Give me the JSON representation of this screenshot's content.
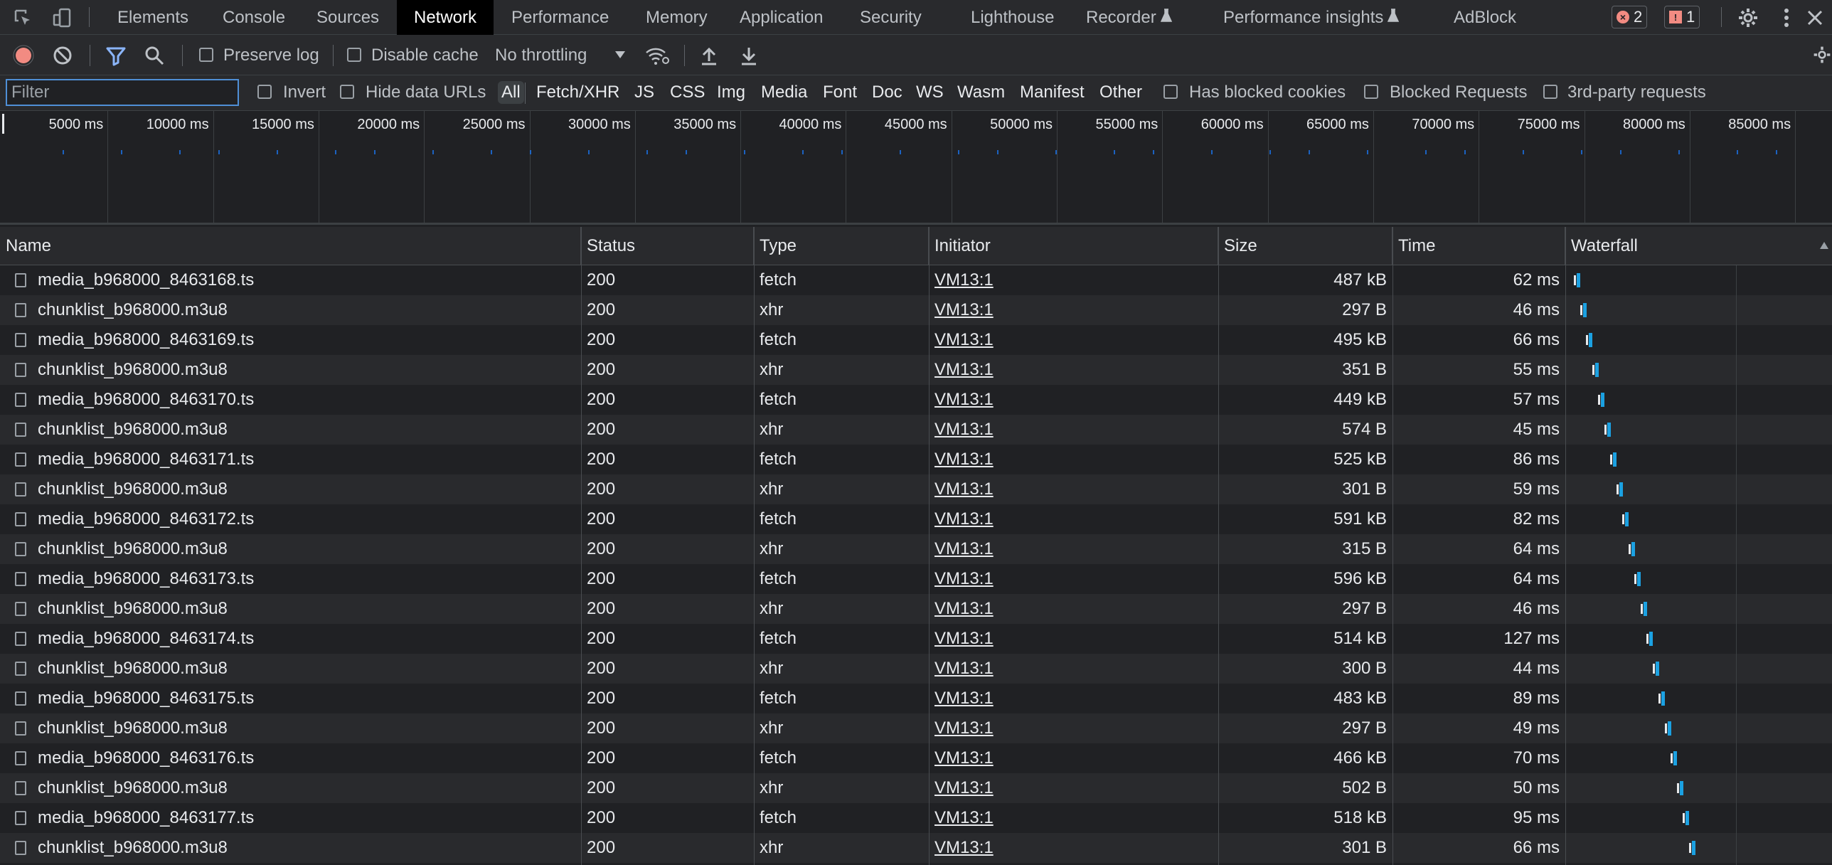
{
  "tabs": [
    {
      "label": "Elements",
      "active": false
    },
    {
      "label": "Console",
      "active": false
    },
    {
      "label": "Sources",
      "active": false
    },
    {
      "label": "Network",
      "active": true
    },
    {
      "label": "Performance",
      "active": false
    },
    {
      "label": "Memory",
      "active": false
    },
    {
      "label": "Application",
      "active": false
    },
    {
      "label": "Security",
      "active": false
    },
    {
      "label": "Lighthouse",
      "active": false
    },
    {
      "label": "Recorder",
      "active": false,
      "experimental": true
    },
    {
      "label": "Performance insights",
      "active": false,
      "experimental": true
    },
    {
      "label": "AdBlock",
      "active": false
    }
  ],
  "badges": {
    "errors": "2",
    "issues": "1"
  },
  "toolbar": {
    "preserve_log": "Preserve log",
    "disable_cache": "Disable cache",
    "throttling": "No throttling"
  },
  "filter": {
    "placeholder": "Filter",
    "invert": "Invert",
    "hide_data_urls": "Hide data URLs",
    "types": [
      "All",
      "Fetch/XHR",
      "JS",
      "CSS",
      "Img",
      "Media",
      "Font",
      "Doc",
      "WS",
      "Wasm",
      "Manifest",
      "Other"
    ],
    "active_type": "All",
    "has_blocked_cookies": "Has blocked cookies",
    "blocked_requests": "Blocked Requests",
    "third_party": "3rd-party requests"
  },
  "overview": {
    "ticks": [
      "5000 ms",
      "10000 ms",
      "15000 ms",
      "20000 ms",
      "25000 ms",
      "30000 ms",
      "35000 ms",
      "40000 ms",
      "45000 ms",
      "50000 ms",
      "55000 ms",
      "60000 ms",
      "65000 ms",
      "70000 ms",
      "75000 ms",
      "80000 ms",
      "85000 ms"
    ]
  },
  "columns": {
    "name": "Name",
    "status": "Status",
    "type": "Type",
    "initiator": "Initiator",
    "size": "Size",
    "time": "Time",
    "waterfall": "Waterfall"
  },
  "requests": [
    {
      "name": "media_b968000_8463168.ts",
      "status": "200",
      "type": "fetch",
      "initiator": "VM13:1",
      "size": "487 kB",
      "time": "62 ms"
    },
    {
      "name": "chunklist_b968000.m3u8",
      "status": "200",
      "type": "xhr",
      "initiator": "VM13:1",
      "size": "297 B",
      "time": "46 ms"
    },
    {
      "name": "media_b968000_8463169.ts",
      "status": "200",
      "type": "fetch",
      "initiator": "VM13:1",
      "size": "495 kB",
      "time": "66 ms"
    },
    {
      "name": "chunklist_b968000.m3u8",
      "status": "200",
      "type": "xhr",
      "initiator": "VM13:1",
      "size": "351 B",
      "time": "55 ms"
    },
    {
      "name": "media_b968000_8463170.ts",
      "status": "200",
      "type": "fetch",
      "initiator": "VM13:1",
      "size": "449 kB",
      "time": "57 ms"
    },
    {
      "name": "chunklist_b968000.m3u8",
      "status": "200",
      "type": "xhr",
      "initiator": "VM13:1",
      "size": "574 B",
      "time": "45 ms"
    },
    {
      "name": "media_b968000_8463171.ts",
      "status": "200",
      "type": "fetch",
      "initiator": "VM13:1",
      "size": "525 kB",
      "time": "86 ms"
    },
    {
      "name": "chunklist_b968000.m3u8",
      "status": "200",
      "type": "xhr",
      "initiator": "VM13:1",
      "size": "301 B",
      "time": "59 ms"
    },
    {
      "name": "media_b968000_8463172.ts",
      "status": "200",
      "type": "fetch",
      "initiator": "VM13:1",
      "size": "591 kB",
      "time": "82 ms"
    },
    {
      "name": "chunklist_b968000.m3u8",
      "status": "200",
      "type": "xhr",
      "initiator": "VM13:1",
      "size": "315 B",
      "time": "64 ms"
    },
    {
      "name": "media_b968000_8463173.ts",
      "status": "200",
      "type": "fetch",
      "initiator": "VM13:1",
      "size": "596 kB",
      "time": "64 ms"
    },
    {
      "name": "chunklist_b968000.m3u8",
      "status": "200",
      "type": "xhr",
      "initiator": "VM13:1",
      "size": "297 B",
      "time": "46 ms"
    },
    {
      "name": "media_b968000_8463174.ts",
      "status": "200",
      "type": "fetch",
      "initiator": "VM13:1",
      "size": "514 kB",
      "time": "127 ms"
    },
    {
      "name": "chunklist_b968000.m3u8",
      "status": "200",
      "type": "xhr",
      "initiator": "VM13:1",
      "size": "300 B",
      "time": "44 ms"
    },
    {
      "name": "media_b968000_8463175.ts",
      "status": "200",
      "type": "fetch",
      "initiator": "VM13:1",
      "size": "483 kB",
      "time": "89 ms"
    },
    {
      "name": "chunklist_b968000.m3u8",
      "status": "200",
      "type": "xhr",
      "initiator": "VM13:1",
      "size": "297 B",
      "time": "49 ms"
    },
    {
      "name": "media_b968000_8463176.ts",
      "status": "200",
      "type": "fetch",
      "initiator": "VM13:1",
      "size": "466 kB",
      "time": "70 ms"
    },
    {
      "name": "chunklist_b968000.m3u8",
      "status": "200",
      "type": "xhr",
      "initiator": "VM13:1",
      "size": "502 B",
      "time": "50 ms"
    },
    {
      "name": "media_b968000_8463177.ts",
      "status": "200",
      "type": "fetch",
      "initiator": "VM13:1",
      "size": "518 kB",
      "time": "95 ms"
    },
    {
      "name": "chunklist_b968000.m3u8",
      "status": "200",
      "type": "xhr",
      "initiator": "VM13:1",
      "size": "301 B",
      "time": "66 ms"
    }
  ],
  "colors": {
    "record": "#f28b82",
    "accent": "#8ab4f8",
    "waterfall_receive": "#1ba1e2",
    "badge_error": "#f28b82"
  }
}
